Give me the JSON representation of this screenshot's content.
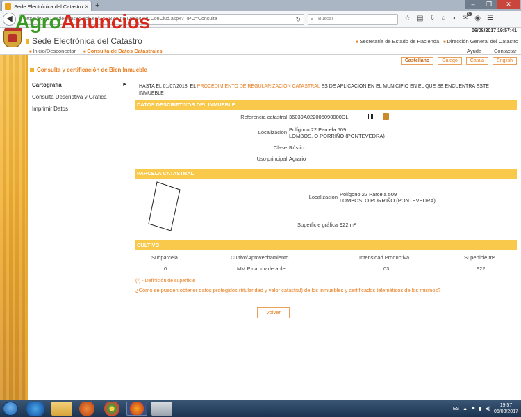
{
  "browser": {
    "tab_title": "Sede Electrónica del Catastro",
    "tab_close": "×",
    "new_tab": "+",
    "url": "https://www1.sedecatastro.gob.es/CYCBienInmueble/OVCConCiud.aspx?TIPO=Consulta",
    "search_placeholder": "Buscar",
    "notifications_count": "0",
    "minimize": "–",
    "maximize": "❐",
    "close": "✕"
  },
  "watermark": {
    "part1": "Agro",
    "part2": "Anuncios"
  },
  "header": {
    "datetime": "06/08/2017  19:57:41",
    "site_title": "Sede Electrónica del Catastro",
    "top_links": [
      "Secretaría de Estado de Hacienda",
      "Dirección General del Catastro"
    ]
  },
  "menu": {
    "home": "Inicio/Desconectar",
    "current": "Consulta de Datos Catastrales",
    "help": "Ayuda",
    "contact": "Contactar"
  },
  "languages": [
    "Castellano",
    "Galego",
    "Català",
    "English"
  ],
  "page_title": "Consulta y certificación de Bien Inmueble",
  "sidebar": {
    "items": [
      "Cartografía",
      "Consulta Descriptiva y Gráfica",
      "Imprimir Datos"
    ]
  },
  "notice": {
    "text_before": "HASTA EL 01/07/2018, EL ",
    "link": "PROCEDIMIENTO DE REGULARIZACIÓN CATASTRAL",
    "text_after": " ES DE APLICACIÓN EN EL MUNICIPIO EN EL QUE SE ENCUENTRA ESTE INMUEBLE"
  },
  "section_descriptive": {
    "title": "DATOS DESCRIPTIVOS DEL INMUEBLE",
    "ref_label": "Referencia catastral",
    "ref_value": "36039A022005090000DL",
    "loc_label": "Localización",
    "loc_line1": "Polígono 22 Parcela 509",
    "loc_line2": "LOMBOS. O PORRIÑO (PONTEVEDRA)",
    "class_label": "Clase",
    "class_value": "Rústico",
    "use_label": "Uso principal",
    "use_value": "Agrario"
  },
  "section_parcel": {
    "title": "PARCELA CATASTRAL",
    "loc_label": "Localización",
    "loc_line1": "Polígono 22 Parcela 509",
    "loc_line2": "LOMBOS. O PORRIÑO (PONTEVEDRA)",
    "surface_label": "Superficie gráfica",
    "surface_value": "922 m²"
  },
  "section_crop": {
    "title": "CULTIVO",
    "headers": [
      "Subparcela",
      "Cultivo/Aprovechamiento",
      "Intensidad Productiva",
      "Superficie m²"
    ],
    "row": [
      "0",
      "MM Pinar maderable",
      "03",
      "922"
    ]
  },
  "footer": {
    "definition_link": "(*) - Definición de superficie",
    "protected_link": "¿Cómo se pueden obtener datos protegidos (titularidad y valor catastral) de los inmuebles y certificados telemáticos de los mismos?",
    "back_button": "Volver"
  },
  "taskbar": {
    "language": "ES",
    "time": "19:57",
    "date": "06/08/2017"
  }
}
